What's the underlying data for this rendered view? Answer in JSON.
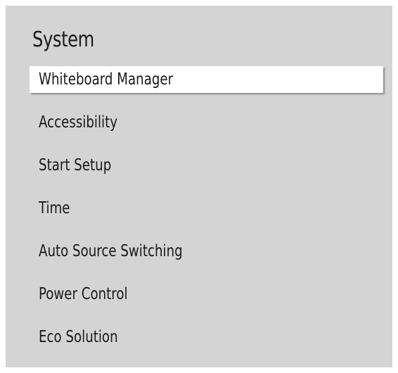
{
  "panel": {
    "title": "System",
    "items": [
      {
        "label": "Whiteboard Manager",
        "selected": true
      },
      {
        "label": "Accessibility",
        "selected": false
      },
      {
        "label": "Start Setup",
        "selected": false
      },
      {
        "label": "Time",
        "selected": false
      },
      {
        "label": "Auto Source Switching",
        "selected": false
      },
      {
        "label": "Power Control",
        "selected": false
      },
      {
        "label": "Eco Solution",
        "selected": false
      }
    ]
  },
  "colors": {
    "panel_background": "#d4d4d4",
    "selected_background": "#ffffff",
    "text": "#1a1a1a"
  }
}
